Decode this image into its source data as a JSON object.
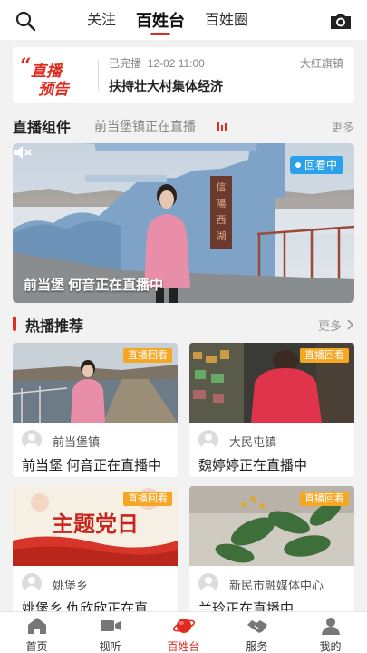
{
  "header": {
    "tabs": [
      {
        "label": "关注",
        "active": false
      },
      {
        "label": "百姓台",
        "active": true
      },
      {
        "label": "百姓圈",
        "active": false
      }
    ],
    "search_icon": "search-icon",
    "camera_icon": "camera-icon"
  },
  "preview": {
    "logo_line1": "直播",
    "logo_line2": "预告",
    "status": "已完播",
    "datetime": "12-02 11:00",
    "channel": "大红旗镇",
    "title": "扶持壮大村集体经济"
  },
  "live_section": {
    "title": "直播组件",
    "subtitle": "前当堡镇正在直播",
    "more": "更多"
  },
  "live_card": {
    "badge": "回看中",
    "title": "前当堡 何音正在直播中",
    "sign_text": "信陽西湖"
  },
  "hot_section": {
    "title": "热播推荐",
    "more": "更多"
  },
  "cards": [
    {
      "badge": "直播回看",
      "source": "前当堡镇",
      "title": "前当堡 何音正在直播中"
    },
    {
      "badge": "直播回看",
      "source": "大民屯镇",
      "title": "魏婷婷正在直播中"
    },
    {
      "badge": "直播回看",
      "source": "姚堡乡",
      "title": "姚堡乡 仇欣欣正在直播中",
      "banner_text": "主题党日"
    },
    {
      "badge": "直播回看",
      "source": "新民市融媒体中心",
      "title": "兰玲正在直播中"
    }
  ],
  "bottom_nav": [
    {
      "label": "首页",
      "icon": "home-icon",
      "active": false
    },
    {
      "label": "视听",
      "icon": "video-icon",
      "active": false
    },
    {
      "label": "百姓台",
      "icon": "planet-icon",
      "active": true
    },
    {
      "label": "服务",
      "icon": "handshake-icon",
      "active": false
    },
    {
      "label": "我的",
      "icon": "user-icon",
      "active": false
    }
  ],
  "colors": {
    "accent": "#e02b20",
    "badge_live": "#2aa1e8",
    "badge_replay": "#f5a623"
  }
}
